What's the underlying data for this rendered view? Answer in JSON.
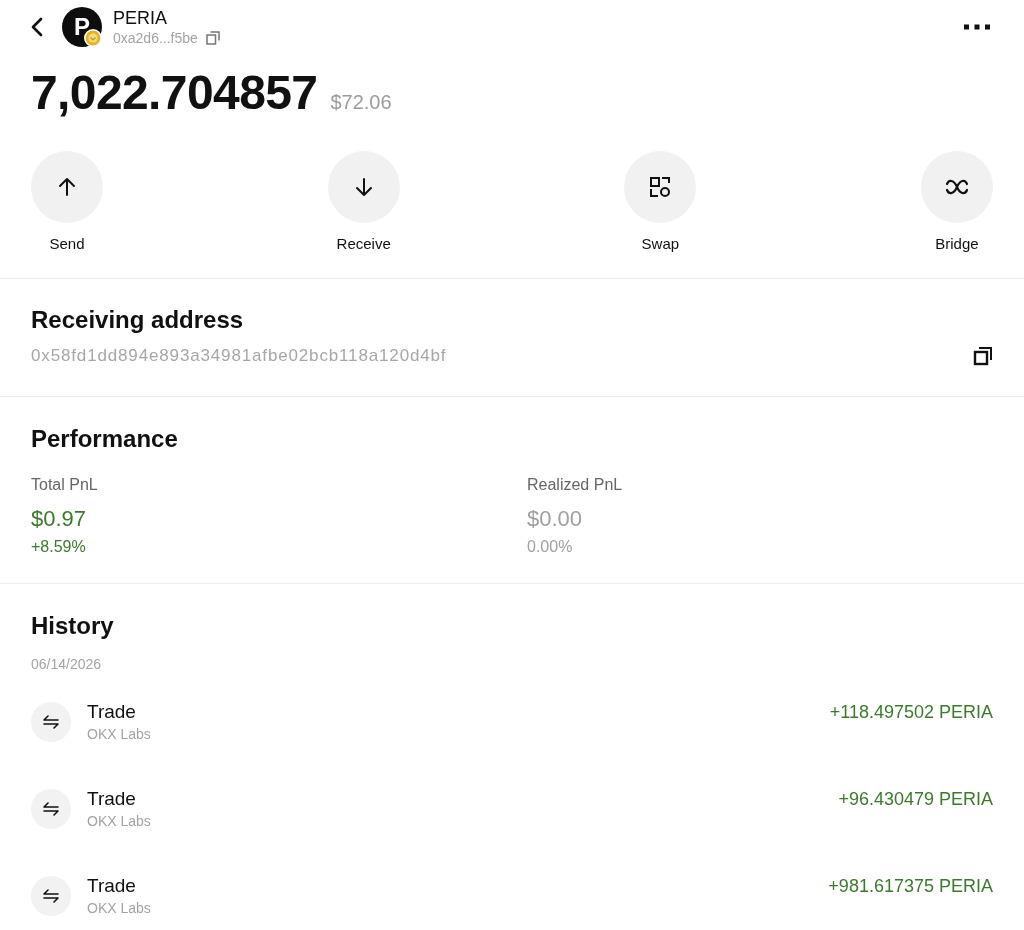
{
  "token": {
    "logo_letter": "P",
    "name": "PERIA",
    "short_address": "0xa2d6...f5be"
  },
  "balance": {
    "amount": "7,022.704857",
    "fiat": "$72.06"
  },
  "actions": [
    {
      "kind": "send",
      "label": "Send"
    },
    {
      "kind": "receive",
      "label": "Receive"
    },
    {
      "kind": "swap",
      "label": "Swap"
    },
    {
      "kind": "bridge",
      "label": "Bridge"
    }
  ],
  "receiving_address": {
    "title": "Receiving address",
    "address": "0x58fd1dd894e893a34981afbe02bcb118a120d4bf"
  },
  "performance": {
    "title": "Performance",
    "metrics": [
      {
        "kind": "gain",
        "label": "Total PnL",
        "value": "$0.97",
        "change": "+8.59%"
      },
      {
        "kind": "neutral",
        "label": "Realized PnL",
        "value": "$0.00",
        "change": "0.00%"
      }
    ]
  },
  "history": {
    "title": "History",
    "groups": [
      {
        "date": "06/14/2026",
        "items": [
          {
            "kind": "trade",
            "title": "Trade",
            "source": "OKX Labs",
            "amount": "+118.497502 PERIA"
          },
          {
            "kind": "trade",
            "title": "Trade",
            "source": "OKX Labs",
            "amount": "+96.430479 PERIA"
          },
          {
            "kind": "trade",
            "title": "Trade",
            "source": "OKX Labs",
            "amount": "+981.617375 PERIA"
          }
        ]
      }
    ]
  }
}
